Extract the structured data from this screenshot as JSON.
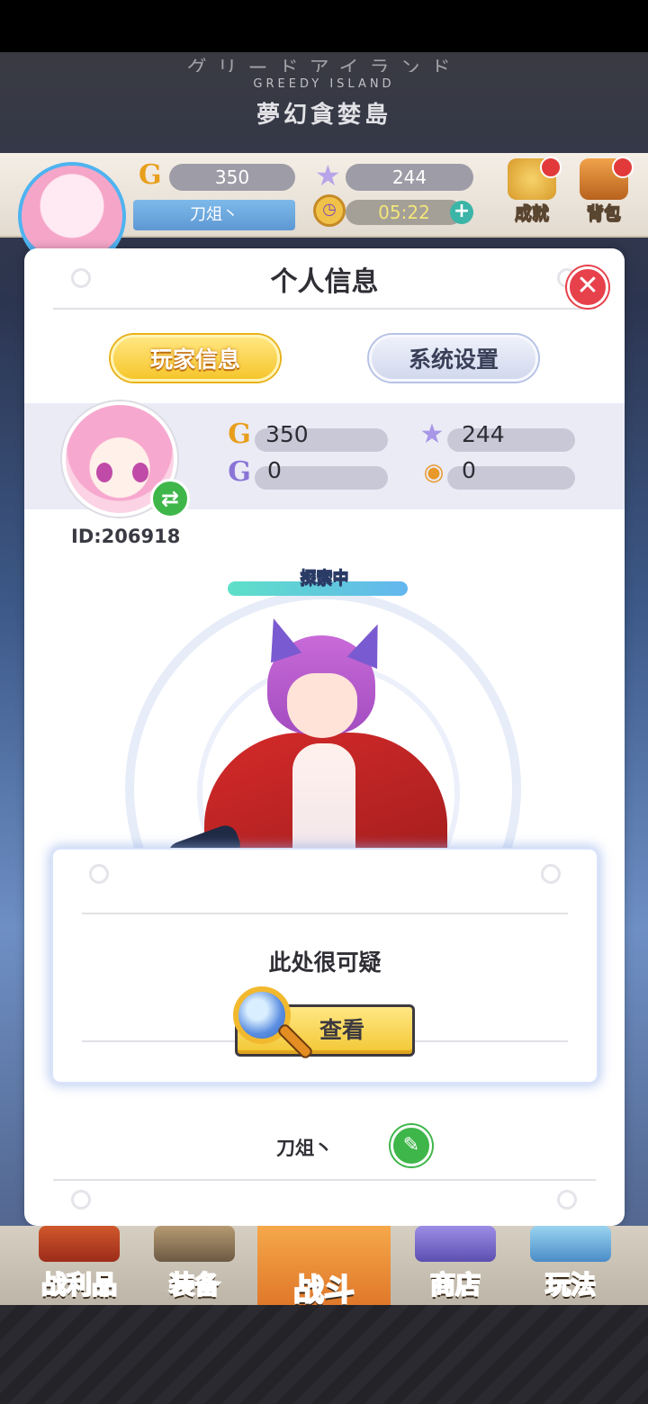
{
  "game": {
    "logo_en": "GREEDY ISLAND",
    "logo_cn": "夢幻貪婪島",
    "logo_top": "グリードアイランド"
  },
  "hud": {
    "gold": "350",
    "stars": "244",
    "name": "刀俎丶",
    "timer": "05:22",
    "plus_icon": "plus-icon",
    "achievement_label": "成就",
    "bag_label": "背包"
  },
  "dialog": {
    "title": "个人信息",
    "tabs": [
      {
        "label": "玩家信息",
        "active": true
      },
      {
        "label": "系统设置",
        "active": false
      }
    ],
    "player_id": "ID:206918",
    "stats": {
      "gold": "350",
      "stars": "244",
      "g_coin": "0",
      "medal": "0"
    },
    "explore_label": "探索中",
    "popup": {
      "text": "此处很可疑",
      "button_label": "查看"
    },
    "nickname": "刀俎丶"
  },
  "nav": {
    "items": [
      {
        "label": "战利品",
        "color": "#3a6fd8"
      },
      {
        "label": "装备",
        "color": "#e23a3a"
      },
      {
        "label": "战斗",
        "color": "#7a6fd0"
      },
      {
        "label": "商店",
        "color": "#2aa84a"
      },
      {
        "label": "玩法",
        "color": "#2aa84a"
      }
    ]
  },
  "colors": {
    "accent_yellow": "#f6c62c",
    "close_red": "#e7414c",
    "green": "#3fb64a"
  }
}
